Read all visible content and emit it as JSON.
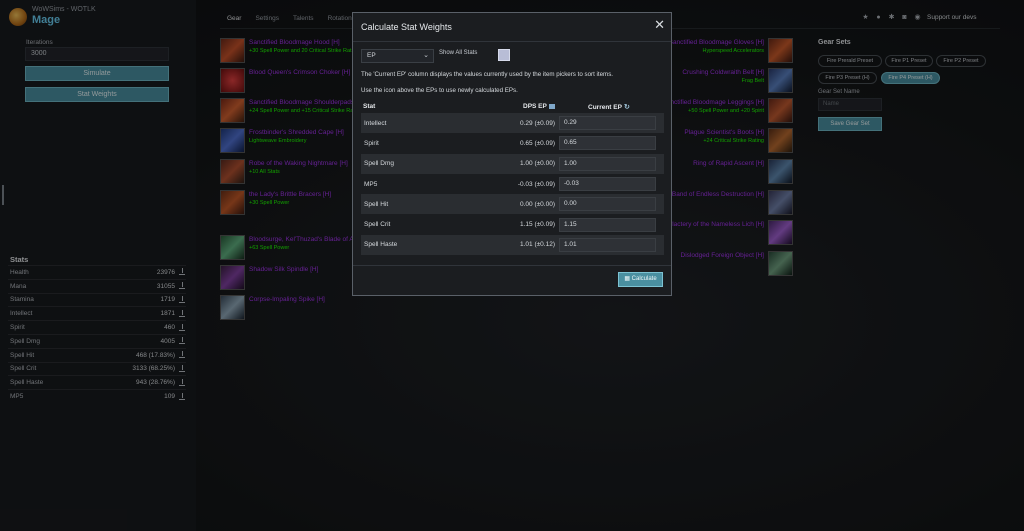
{
  "app": {
    "name": "WoWSims - WOTLK",
    "class": "Mage"
  },
  "sidebar": {
    "iterations_label": "Iterations",
    "iterations_value": "3000",
    "simulate_label": "Simulate",
    "stat_weights_label": "Stat Weights",
    "stats_title": "Stats",
    "stats": [
      {
        "name": "Health",
        "value": "23976"
      },
      {
        "name": "Mana",
        "value": "31055"
      },
      {
        "name": "Stamina",
        "value": "1719"
      },
      {
        "name": "Intellect",
        "value": "1871"
      },
      {
        "name": "Spirit",
        "value": "460"
      },
      {
        "name": "Spell Dmg",
        "value": "4005"
      },
      {
        "name": "Spell Hit",
        "value": "468 (17.83%)"
      },
      {
        "name": "Spell Crit",
        "value": "3133 (68.25%)"
      },
      {
        "name": "Spell Haste",
        "value": "943 (28.76%)"
      },
      {
        "name": "MP5",
        "value": "109"
      }
    ]
  },
  "tabs": [
    "Gear",
    "Settings",
    "Talents",
    "Rotation"
  ],
  "header": {
    "support_label": "Support our devs"
  },
  "gear_left": [
    {
      "name": "Sanctified Bloodmage Hood [H]",
      "sub": "+30 Spell Power and 20 Critical Strike Rating"
    },
    {
      "name": "Blood Queen's Crimson Choker [H]",
      "sub": ""
    },
    {
      "name": "Sanctified Bloodmage Shoulderpads [H]",
      "sub": "+24 Spell Power and +15 Critical Strike Rating"
    },
    {
      "name": "Frostbinder's Shredded Cape [H]",
      "sub": "Lightweave Embroidery"
    },
    {
      "name": "Robe of the Waking Nightmare [H]",
      "sub": "+10 All Stats"
    },
    {
      "name": "the Lady's Brittle Bracers [H]",
      "sub": "+30 Spell Power"
    },
    {
      "name": "Bloodsurge, Kel'Thuzad's Blade of Agony [H]",
      "sub": "+63 Spell Power"
    },
    {
      "name": "Shadow Silk Spindle [H]",
      "sub": ""
    },
    {
      "name": "Corpse-Impaling Spike [H]",
      "sub": ""
    }
  ],
  "gear_right": [
    {
      "name": "Sanctified Bloodmage Gloves [H]",
      "sub": "Hyperspeed Accelerators"
    },
    {
      "name": "Crushing Coldwraith Belt [H]",
      "sub": "Frag Belt"
    },
    {
      "name": "Sanctified Bloodmage Leggings [H]",
      "sub": "+50 Spell Power and +20 Spirit"
    },
    {
      "name": "Plague Scientist's Boots [H]",
      "sub": "+24 Critical Strike Rating"
    },
    {
      "name": "Ring of Rapid Ascent [H]",
      "sub": ""
    },
    {
      "name": "Band of Endless Destruction [H]",
      "sub": ""
    },
    {
      "name": "Phylactery of the Nameless Lich [H]",
      "sub": ""
    },
    {
      "name": "Dislodged Foreign Object [H]",
      "sub": ""
    }
  ],
  "gear_sets": {
    "title": "Gear Sets",
    "presets": [
      "Fire Prerald Preset",
      "Fire P1 Preset",
      "Fire P2 Preset",
      "Fire P3 Preset (H)",
      "Fire P4 Preset (H)"
    ],
    "name_label": "Gear Set Name",
    "name_placeholder": "Name",
    "save_label": "Save Gear Set"
  },
  "modal": {
    "title": "Calculate Stat Weights",
    "ep_select": "EP",
    "show_all_label": "Show All Stats",
    "desc1": "The 'Current EP' column displays the values currently used by the item pickers to sort items.",
    "desc2": "Use the   icon above the EPs to use newly calculated EPs.",
    "col_stat": "Stat",
    "col_dps": "DPS EP",
    "col_current": "Current EP",
    "rows": [
      {
        "stat": "Intellect",
        "dps": "0.29 (±0.09)",
        "current": "0.29"
      },
      {
        "stat": "Spirit",
        "dps": "0.65 (±0.09)",
        "current": "0.65"
      },
      {
        "stat": "Spell Dmg",
        "dps": "1.00 (±0.00)",
        "current": "1.00"
      },
      {
        "stat": "MP5",
        "dps": "-0.03 (±0.09)",
        "current": "-0.03"
      },
      {
        "stat": "Spell Hit",
        "dps": "0.00 (±0.00)",
        "current": "0.00"
      },
      {
        "stat": "Spell Crit",
        "dps": "1.15 (±0.09)",
        "current": "1.15"
      },
      {
        "stat": "Spell Haste",
        "dps": "1.01 (±0.12)",
        "current": "1.01"
      }
    ],
    "calculate_label": "Calculate"
  },
  "colors": {
    "accent": "#4a8fa0",
    "epic": "#a335ee",
    "uncommon": "#1eff00",
    "mage": "#69ccf0"
  }
}
